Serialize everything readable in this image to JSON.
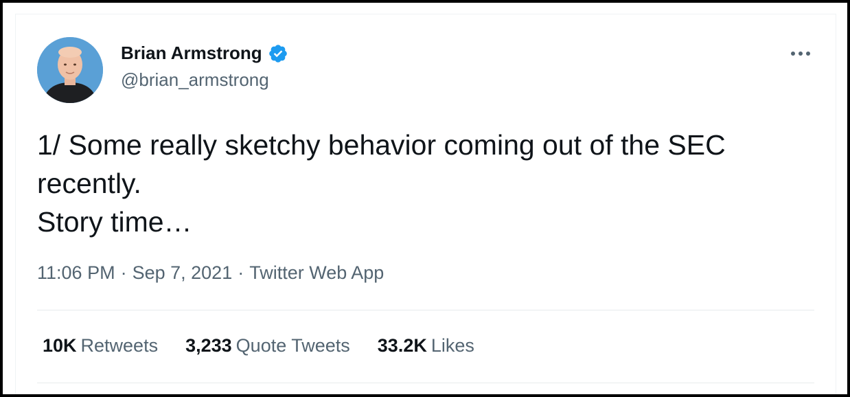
{
  "tweet": {
    "author": {
      "display_name": "Brian Armstrong",
      "handle": "@brian_armstrong",
      "verified": true
    },
    "text": "1/ Some really sketchy behavior coming out of the SEC recently.\nStory time…",
    "time": "11:06 PM",
    "date": "Sep 7, 2021",
    "separator": "·",
    "source": "Twitter Web App",
    "stats": [
      {
        "value": "10K",
        "label": "Retweets"
      },
      {
        "value": "3,233",
        "label": "Quote Tweets"
      },
      {
        "value": "33.2K",
        "label": "Likes"
      }
    ]
  },
  "icons": {
    "verified": "verified-badge-icon",
    "more": "more-options-icon"
  },
  "colors": {
    "text_primary": "#0f1419",
    "text_secondary": "#536471",
    "verified_blue": "#1d9bf0",
    "divider": "#e7ebec"
  }
}
